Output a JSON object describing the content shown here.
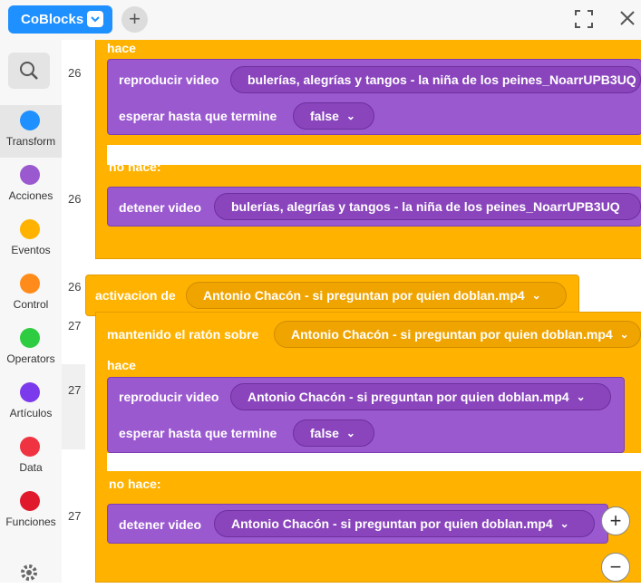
{
  "app": {
    "name": "CoBlocks"
  },
  "categories": [
    {
      "label": "Transform",
      "color": "#1e90ff",
      "icon": "transform-icon"
    },
    {
      "label": "Acciones",
      "color": "#9b59d0",
      "icon": "acciones-icon"
    },
    {
      "label": "Eventos",
      "color": "#ffb300",
      "icon": "eventos-icon"
    },
    {
      "label": "Control",
      "color": "#ff8c1a",
      "icon": "control-icon"
    },
    {
      "label": "Operators",
      "color": "#2ecc40",
      "icon": "operators-icon"
    },
    {
      "label": "Artículos",
      "color": "#7c3aed",
      "icon": "articulos-icon"
    },
    {
      "label": "Data",
      "color": "#ef3340",
      "icon": "data-icon"
    },
    {
      "label": "Funciones",
      "color": "#e0192c",
      "icon": "funciones-icon"
    }
  ],
  "line_numbers": [
    "26",
    "26",
    "26",
    "27",
    "27",
    "27"
  ],
  "blocks": {
    "hace": "hace",
    "no_hace": "no hace:",
    "play_video": "reproducir video",
    "wait_end": "esperar hasta que termine",
    "stop_video": "detener video",
    "activation": "activacion de",
    "hover": "mantenido el ratón sobre",
    "false_value": "false",
    "video_a": "bulerías, alegrías y tangos - la niña de los peines_NoarrUPB3UQ",
    "video_b": "Antonio Chacón - si preguntan por quien doblan.mp4"
  },
  "zoom": {
    "in": "+",
    "out": "−"
  },
  "colors": {
    "control": "#ffb300",
    "action": "#9b59d0",
    "brand": "#1e90ff"
  }
}
